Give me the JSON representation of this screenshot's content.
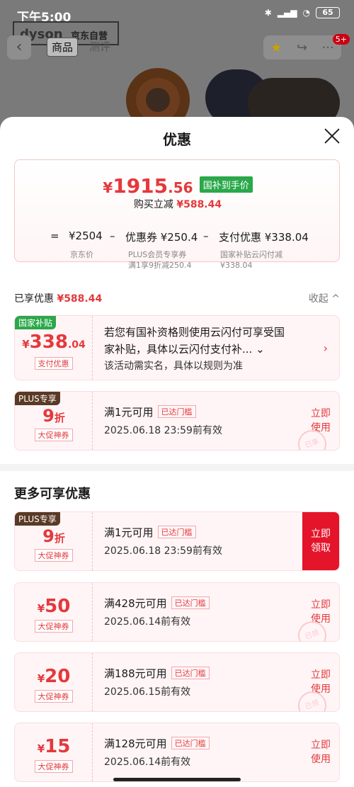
{
  "status": {
    "time": "下午5:00",
    "battery": "65"
  },
  "header": {
    "brand_logo": "dyson",
    "brand_store": "京东自营",
    "tabs": [
      "商品",
      "测评"
    ],
    "badge": "5+"
  },
  "sheet": {
    "title": "优惠",
    "final_price": {
      "yen": "¥",
      "int": "1915",
      "dec": ".56",
      "tag": "国补到手价"
    },
    "buy_reduce": {
      "label": "购买立减",
      "value": "¥588.44"
    },
    "formula": {
      "eq": "=",
      "jd_price": "¥2504",
      "minus1": "–",
      "coupon": "优惠券 ¥250.4",
      "minus2": "–",
      "pay": "支付优惠 ¥338.04",
      "jd_label": "京东价",
      "coupon_sub1": "PLUS会员专享券",
      "coupon_sub2": "满1享9折减250.4",
      "pay_sub1": "国家补贴云闪付减",
      "pay_sub2": "¥338.04"
    },
    "enjoyed": {
      "label": "已享优惠",
      "value": "¥588.44",
      "collapse": "收起 ^"
    }
  },
  "cards": [
    {
      "tag": "国家补贴",
      "yen": "¥",
      "amount": "338",
      "dec": ".04",
      "label": "支付优惠",
      "line1": "若您有国补资格则使用云闪付可享受国",
      "line2": "家补贴，具体以云闪付支付补... ⌄",
      "line3": "该活动需实名，具体以规则为准",
      "btn": "›"
    },
    {
      "tag": "PLUS专享",
      "amount": "9",
      "unit": "折",
      "label": "大促神券",
      "line1": "满1元可用",
      "reached": "已达门槛",
      "line2": "2025.06.18 23:59前有效",
      "btn1": "立即",
      "btn2": "使用",
      "stamp": "已享"
    }
  ],
  "more_title": "更多可享优惠",
  "more_cards": [
    {
      "tag": "PLUS专享",
      "amount": "9",
      "unit": "折",
      "label": "大促神券",
      "line1": "满1元可用",
      "reached": "已达门槛",
      "line2": "2025.06.18 23:59前有效",
      "btn1": "立即",
      "btn2": "领取"
    },
    {
      "yen": "¥",
      "amount": "50",
      "label": "大促神券",
      "line1": "满428元可用",
      "reached": "已达门槛",
      "line2": "2025.06.14前有效",
      "btn1": "立即",
      "btn2": "使用",
      "stamp": "已领"
    },
    {
      "yen": "¥",
      "amount": "20",
      "label": "大促神券",
      "line1": "满188元可用",
      "reached": "已达门槛",
      "line2": "2025.06.15前有效",
      "btn1": "立即",
      "btn2": "使用",
      "stamp": "已领"
    },
    {
      "yen": "¥",
      "amount": "15",
      "label": "大促神券",
      "line1": "满128元可用",
      "reached": "已达门槛",
      "line2": "2025.06.14前有效",
      "btn1": "立即",
      "btn2": "使用"
    }
  ],
  "colors": {
    "accent": "#e4393c",
    "green_tag": "#2aa84a",
    "plus_tag": "#5a3a25"
  }
}
